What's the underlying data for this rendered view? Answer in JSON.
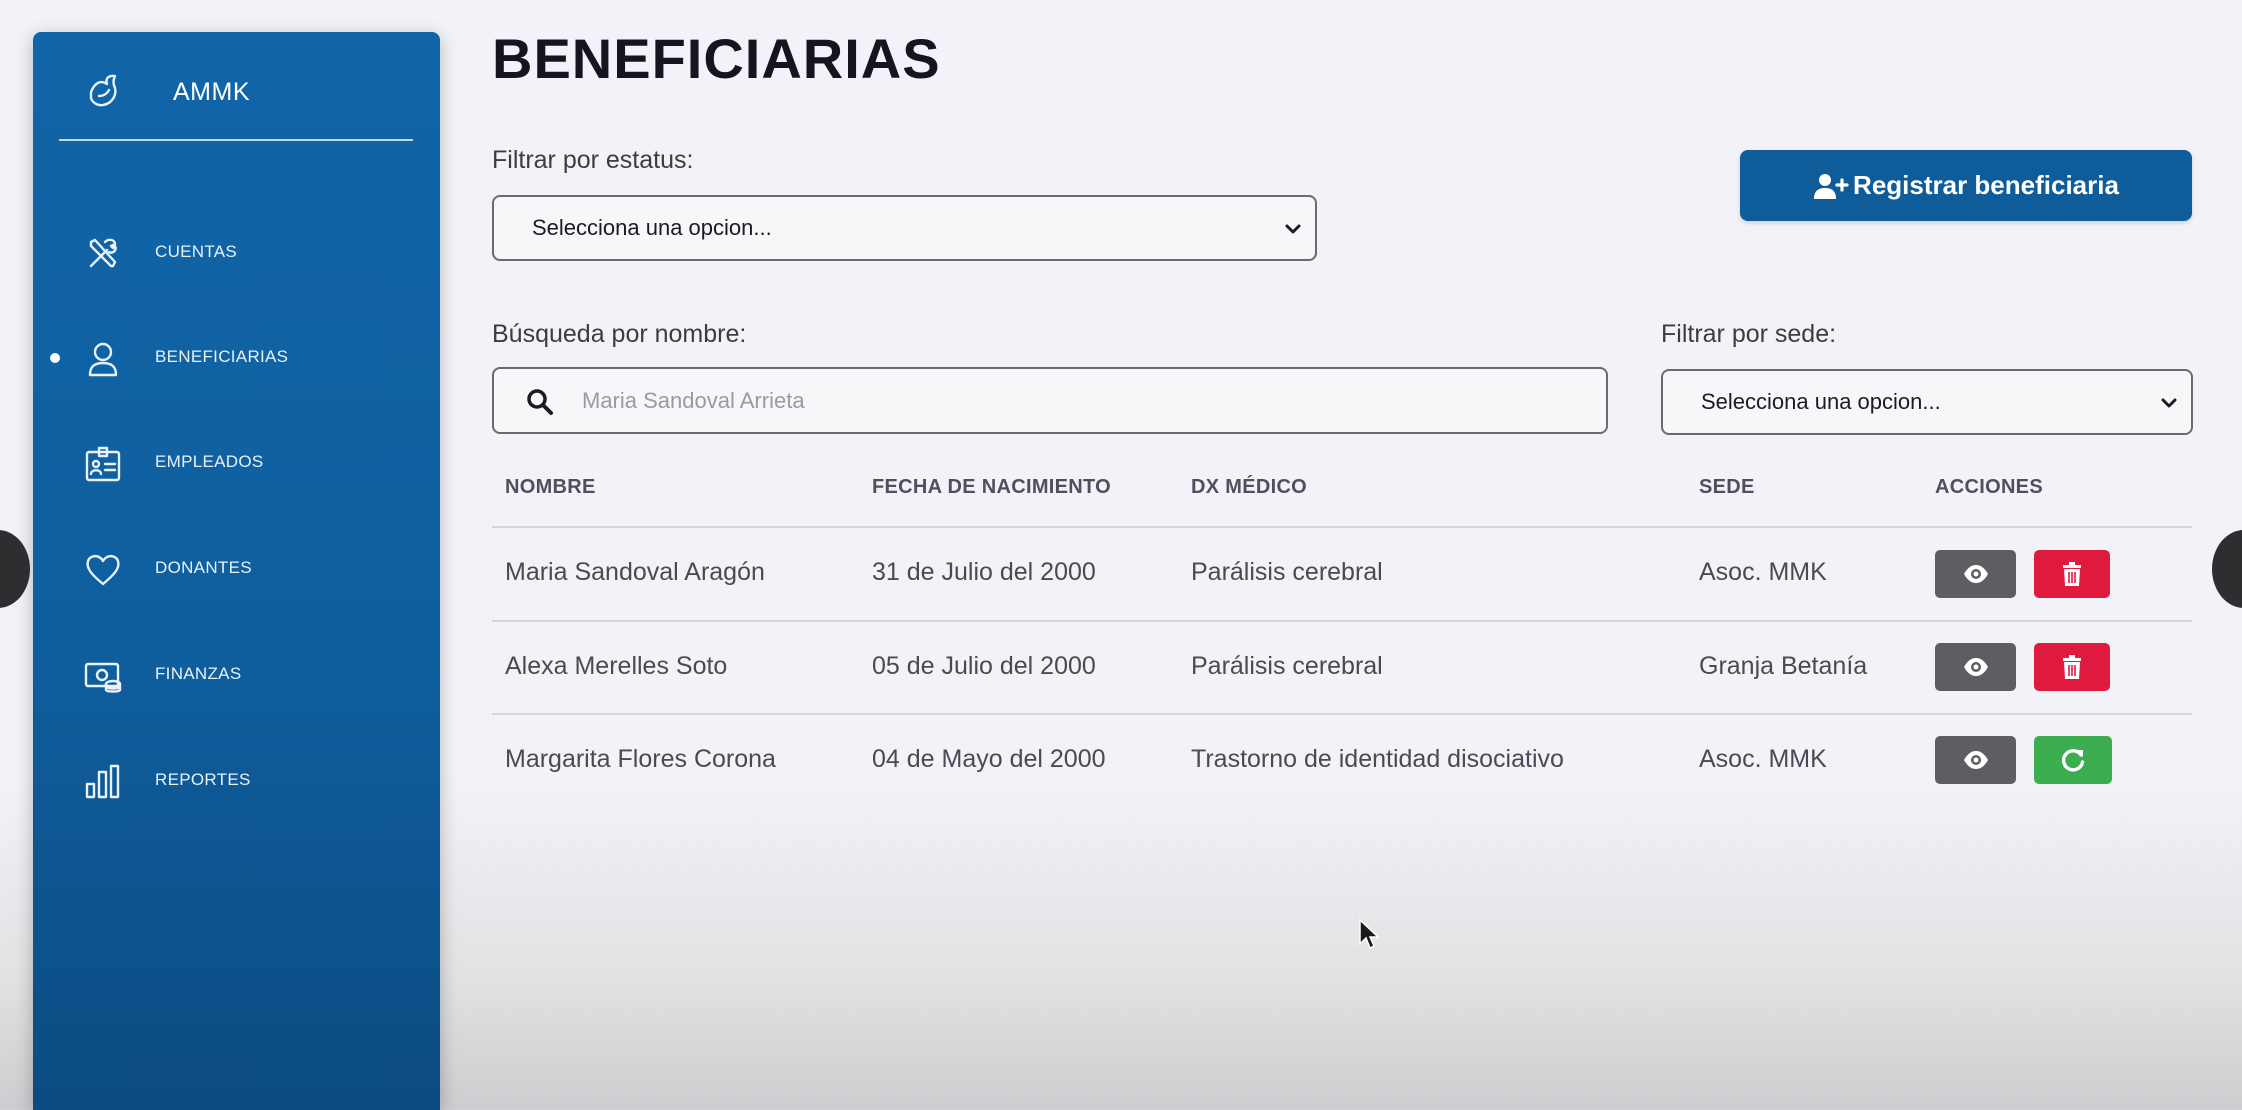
{
  "sidebar": {
    "brand": "AMMK",
    "items": [
      {
        "label": "CUENTAS",
        "icon": "tools-icon"
      },
      {
        "label": "BENEFICIARIAS",
        "icon": "user-icon",
        "active": true
      },
      {
        "label": "EMPLEADOS",
        "icon": "id-card-icon"
      },
      {
        "label": "DONANTES",
        "icon": "heart-icon"
      },
      {
        "label": "FINANZAS",
        "icon": "money-icon"
      },
      {
        "label": "REPORTES",
        "icon": "bar-chart-icon"
      }
    ]
  },
  "page": {
    "title": "BENEFICIARIAS"
  },
  "filters": {
    "status_label": "Filtrar por estatus:",
    "status_value": "Selecciona una opcion...",
    "search_label": "Búsqueda por nombre:",
    "search_placeholder": "Maria Sandoval Arrieta",
    "sede_label": "Filtrar por sede:",
    "sede_value": "Selecciona una opcion..."
  },
  "actions": {
    "register_label": "Registrar beneficiaria"
  },
  "table": {
    "headers": [
      "NOMBRE",
      "FECHA DE NACIMIENTO",
      "DX MÉDICO",
      "SEDE",
      "ACCIONES"
    ],
    "rows": [
      {
        "nombre": "Maria Sandoval Aragón",
        "fecha": "31 de Julio del 2000",
        "dx": "Parálisis cerebral",
        "sede": "Asoc. MMK",
        "second_action": "delete"
      },
      {
        "nombre": "Alexa Merelles Soto",
        "fecha": "05 de Julio del 2000",
        "dx": "Parálisis cerebral",
        "sede": "Granja Betanía",
        "second_action": "delete"
      },
      {
        "nombre": "Margarita Flores Corona",
        "fecha": "04 de Mayo del 2000",
        "dx": "Trastorno de identidad disociativo",
        "sede": "Asoc. MMK",
        "second_action": "restore"
      }
    ]
  },
  "colors": {
    "sidebar": "#1065a8",
    "primary_button": "#0f5c9a",
    "view_button": "#5e5e62",
    "delete_button": "#e0193f",
    "restore_button": "#3cae4f"
  }
}
